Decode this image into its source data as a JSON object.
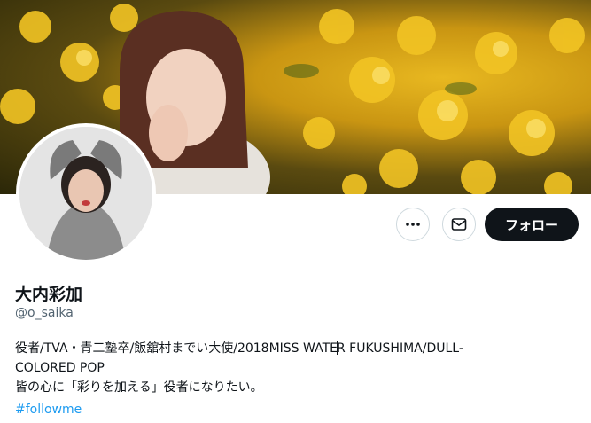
{
  "profile": {
    "display_name": "大内彩加",
    "handle": "@o_saika",
    "bio_line1a": "役者/TVA・青二塾卒/飯舘村までい大使/2018MISS WATE",
    "bio_line1b": "R FUKUSHIMA/DULL-",
    "bio_line2": "COLORED POP",
    "bio_line3": "皆の心に「彩りを加える」役者になりたい。",
    "hashtag": "#followme"
  },
  "actions": {
    "more_icon": "more-horizontal-icon",
    "message_icon": "envelope-icon",
    "follow_label": "フォロー"
  },
  "colors": {
    "follow_bg": "#0f1419",
    "hashtag": "#1d9bf0",
    "secondary_text": "#536471",
    "banner_flowers": "#e8b820"
  }
}
